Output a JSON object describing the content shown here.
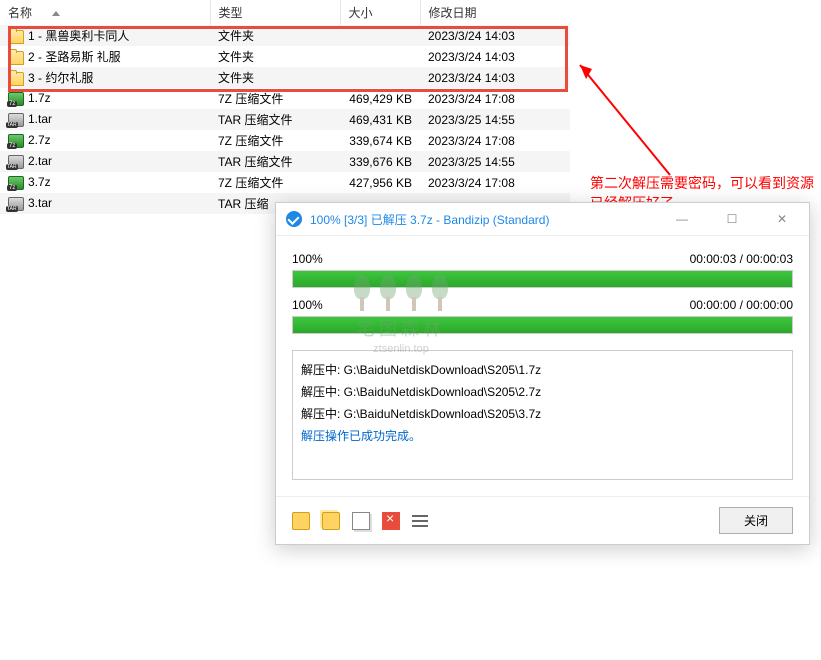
{
  "columns": {
    "name": "名称",
    "type": "类型",
    "size": "大小",
    "date": "修改日期"
  },
  "rows": [
    {
      "icon": "folder",
      "name": "1 - 黑兽奥利卡同人",
      "type": "文件夹",
      "size": "",
      "date": "2023/3/24 14:03"
    },
    {
      "icon": "folder",
      "name": "2 - 圣路易斯 礼服",
      "type": "文件夹",
      "size": "",
      "date": "2023/3/24 14:03"
    },
    {
      "icon": "folder",
      "name": "3 - 约尔礼服",
      "type": "文件夹",
      "size": "",
      "date": "2023/3/24 14:03"
    },
    {
      "icon": "7z",
      "name": "1.7z",
      "type": "7Z 压缩文件",
      "size": "469,429 KB",
      "date": "2023/3/24 17:08"
    },
    {
      "icon": "tar",
      "name": "1.tar",
      "type": "TAR 压缩文件",
      "size": "469,431 KB",
      "date": "2023/3/25 14:55"
    },
    {
      "icon": "7z",
      "name": "2.7z",
      "type": "7Z 压缩文件",
      "size": "339,674 KB",
      "date": "2023/3/24 17:08"
    },
    {
      "icon": "tar",
      "name": "2.tar",
      "type": "TAR 压缩文件",
      "size": "339,676 KB",
      "date": "2023/3/25 14:55"
    },
    {
      "icon": "7z",
      "name": "3.7z",
      "type": "7Z 压缩文件",
      "size": "427,956 KB",
      "date": "2023/3/24 17:08"
    },
    {
      "icon": "tar",
      "name": "3.tar",
      "type": "TAR 压缩",
      "size": "",
      "date": ""
    }
  ],
  "annotation": {
    "line1": "第二次解压需要密码，可以看到资源",
    "line2": "已经解压好了"
  },
  "watermark": {
    "title": "宅图森林",
    "url": "ztsenlin.top"
  },
  "dialog": {
    "title": "100% [3/3] 已解压 3.7z - Bandizip (Standard)",
    "progress1": {
      "percent": "100%",
      "time": "00:00:03 / 00:00:03"
    },
    "progress2": {
      "percent": "100%",
      "time": "00:00:00 / 00:00:00"
    },
    "log": [
      "解压中: G:\\BaiduNetdiskDownload\\S205\\1.7z",
      "解压中: G:\\BaiduNetdiskDownload\\S205\\2.7z",
      "解压中: G:\\BaiduNetdiskDownload\\S205\\3.7z"
    ],
    "log_success": "解压操作已成功完成。",
    "close": "关闭"
  }
}
